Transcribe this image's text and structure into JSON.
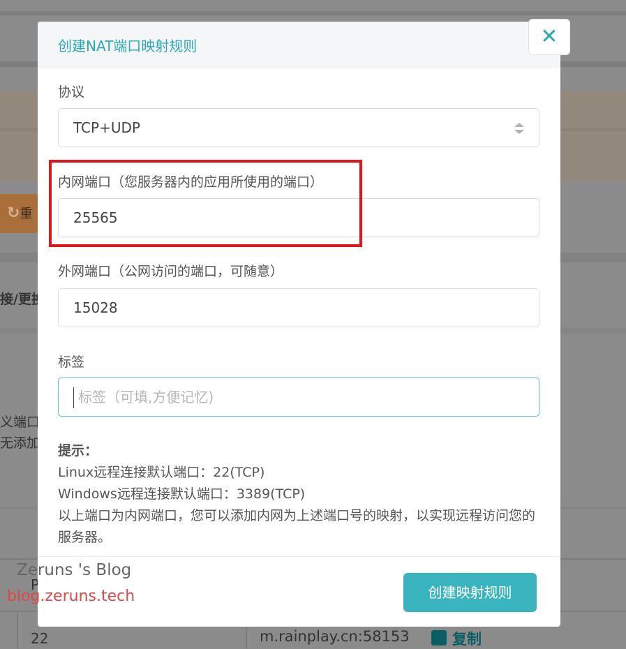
{
  "background": {
    "button_text": "重",
    "column_header": "接/更换",
    "note_line1": "义端口",
    "note_line2": "无添加",
    "table_row": {
      "port_cut": "P",
      "port": "22",
      "host": "m.rainplay.cn:58153",
      "copy_label": "复制"
    }
  },
  "modal": {
    "title": "创建NAT端口映射规则",
    "close_label": "✕",
    "protocol": {
      "label": "协议",
      "value": "TCP+UDP"
    },
    "internal_port": {
      "label": "内网端口（您服务器内的应用所使用的端口）",
      "value": "25565"
    },
    "external_port": {
      "label": "外网端口（公网访问的端口，可随意）",
      "value": "15028"
    },
    "tag": {
      "label": "标签",
      "placeholder": "标签（可填,方便记忆)",
      "value": ""
    },
    "tips": {
      "title": "提示：",
      "line1": "Linux远程连接默认端口：22(TCP)",
      "line2": "Windows远程连接默认端口：3389(TCP)",
      "line3": "以上端口为内网端口，您可以添加内网为上述端口号的映射，以实现远程访问您的服务器。"
    },
    "submit_label": "创建映射规则"
  },
  "watermark": {
    "line1": "Zeruns 's Blog",
    "line2": "blog.zeruns.tech"
  },
  "colors": {
    "accent": "#3ab5bf",
    "highlight": "#e5151e"
  }
}
